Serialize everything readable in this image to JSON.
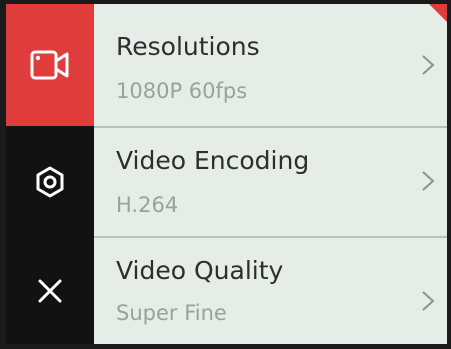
{
  "sidebar": {
    "items": [
      {
        "icon": "video-camera-icon",
        "active": true
      },
      {
        "icon": "settings-hexagon-icon",
        "active": false
      },
      {
        "icon": "close-icon",
        "active": false
      }
    ]
  },
  "menu": {
    "items": [
      {
        "title": "Resolutions",
        "value": "1080P 60fps"
      },
      {
        "title": "Video Encoding",
        "value": "H.264"
      },
      {
        "title": "Video Quality",
        "value": "Super Fine"
      }
    ]
  },
  "colors": {
    "accent": "#e03c3c",
    "panel": "#e6ece8",
    "sidebar": "#121212",
    "title_text": "#2b2f2d",
    "value_text": "#9aa19d"
  }
}
